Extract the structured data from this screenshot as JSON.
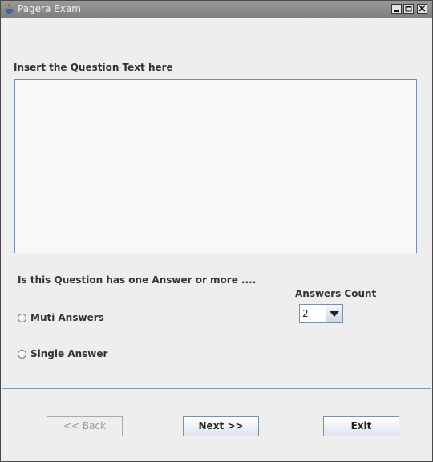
{
  "window": {
    "title": "Pagera Exam",
    "icon": "java-cup-icon"
  },
  "question": {
    "label": "Insert the Question Text here",
    "text": ""
  },
  "answer_type": {
    "label": "Is this Question has one Answer or more ....",
    "options": [
      {
        "label": "Muti Answers",
        "selected": false
      },
      {
        "label": "Single Answer",
        "selected": false
      }
    ]
  },
  "answers_count": {
    "label": "Answers Count",
    "value": "2"
  },
  "buttons": {
    "back": "<< Back",
    "next": "Next >>",
    "exit": "Exit"
  },
  "colors": {
    "titlebar": "#8a8a8a",
    "border_accent": "#7c8fa7",
    "background": "#eeeeee"
  }
}
